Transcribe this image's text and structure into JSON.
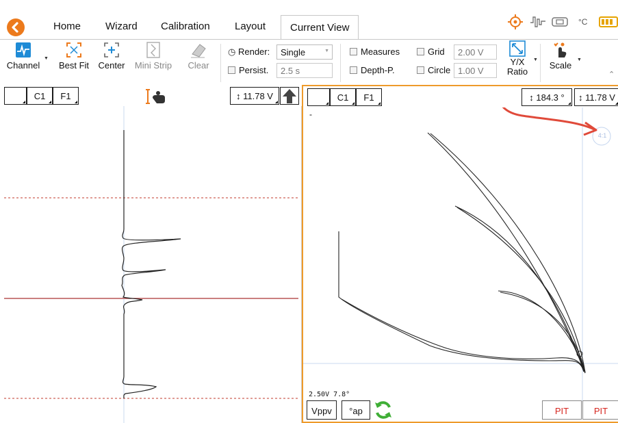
{
  "tabs": [
    {
      "label": "Home",
      "active": false
    },
    {
      "label": "Wizard",
      "active": false
    },
    {
      "label": "Calibration",
      "active": false
    },
    {
      "label": "Layout",
      "active": false
    },
    {
      "label": "Current View",
      "active": true
    }
  ],
  "status_bar": {
    "temp_unit": "°C",
    "icons": [
      "target-icon",
      "signal-icon",
      "probe-icon",
      "temperature-icon",
      "battery-icon"
    ]
  },
  "ribbon": {
    "channel_label": "Channel",
    "best_fit_label": "Best Fit",
    "center_label": "Center",
    "mini_strip_label": "Mini Strip",
    "clear_label": "Clear",
    "render_label": "Render:",
    "render_value": "Single",
    "persist_label": "Persist.",
    "persist_value": "2.5 s",
    "measures_label": "Measures",
    "depth_label": "Depth-P.",
    "grid_label": "Grid",
    "grid_value": "2.00 V",
    "circle_label": "Circle",
    "circle_value": "1.00 V",
    "yx_ratio_label_1": "Y/X",
    "yx_ratio_label_2": "Ratio",
    "scale_label": "Scale"
  },
  "left_pane": {
    "channel": "C1",
    "filter": "F1",
    "voltage": "↕ 11.78 V"
  },
  "right_pane": {
    "channel": "C1",
    "filter": "F1",
    "angle": "↕ 184.3 °",
    "voltage": "↕ 11.78 V",
    "top_left_mark": "-",
    "ratio_badge": "4:1",
    "readout": "2.50V 7.8°",
    "btn_vppv": "Vppv",
    "btn_ap": "°ap",
    "pit_1": "PIT",
    "pit_2": "PIT"
  },
  "colors": {
    "accent_orange": "#ec7a1c",
    "pane_border": "#ee9a2a",
    "annotation_arrow": "#e04a3a",
    "blue_icon": "#1e8bd6",
    "cursor_red": "#c0392b",
    "sync_green": "#3fae36",
    "pit_red": "#d6261f"
  }
}
